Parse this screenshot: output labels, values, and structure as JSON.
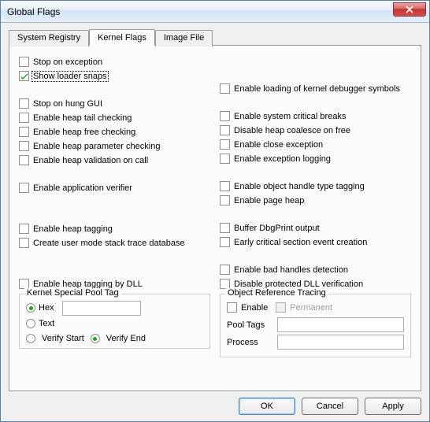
{
  "window": {
    "title": "Global Flags"
  },
  "tabs": [
    {
      "label": "System Registry",
      "active": false
    },
    {
      "label": "Kernel Flags",
      "active": true
    },
    {
      "label": "Image File",
      "active": false
    }
  ],
  "left_checks": {
    "stop_exception": "Stop on exception",
    "show_loader_snaps": "Show loader snaps",
    "stop_hung_gui": "Stop on hung GUI",
    "heap_tail": "Enable heap tail checking",
    "heap_free": "Enable heap free checking",
    "heap_param": "Enable heap parameter checking",
    "heap_validation": "Enable heap validation on call",
    "app_verifier": "Enable application verifier",
    "heap_tagging": "Enable heap tagging",
    "stack_trace_db": "Create user mode stack trace database",
    "heap_tag_dll": "Enable heap tagging by DLL"
  },
  "right_checks": {
    "load_kdbg": "Enable loading of kernel debugger symbols",
    "sys_crit": "Enable system critical breaks",
    "disable_coalesce": "Disable heap coalesce on free",
    "close_exc": "Enable close exception",
    "exc_logging": "Enable exception logging",
    "obj_handle_tag": "Enable object handle type tagging",
    "page_heap": "Enable page heap",
    "buffer_dbg": "Buffer DbgPrint output",
    "early_cs": "Early critical section event creation",
    "bad_handles": "Enable bad handles detection",
    "disable_dll_verify": "Disable protected DLL verification"
  },
  "pool_group": {
    "title": "Kernel Special Pool Tag",
    "hex": "Hex",
    "text": "Text",
    "verify_start": "Verify Start",
    "verify_end": "Verify End",
    "value": ""
  },
  "ort_group": {
    "title": "Object Reference Tracing",
    "enable": "Enable",
    "permanent": "Permanent",
    "pool_tags_label": "Pool Tags",
    "process_label": "Process",
    "pool_tags_value": "",
    "process_value": ""
  },
  "buttons": {
    "ok": "OK",
    "cancel": "Cancel",
    "apply": "Apply"
  }
}
